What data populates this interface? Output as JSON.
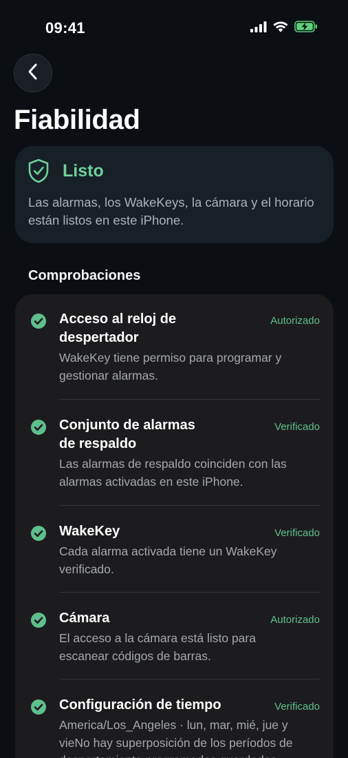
{
  "status_bar": {
    "time": "09:41"
  },
  "header": {
    "title": "Fiabilidad"
  },
  "status_card": {
    "title": "Listo",
    "description": "Las alarmas, los WakeKeys, la cámara y el horario están listos en este iPhone."
  },
  "checks": {
    "heading": "Comprobaciones",
    "items": [
      {
        "title_lines": [
          "Acceso al reloj de",
          "despertador"
        ],
        "badge": "Autorizado",
        "description_lines": [
          "WakeKey tiene permiso para programar y",
          "gestionar alarmas."
        ]
      },
      {
        "title_lines": [
          "Conjunto de alarmas",
          "de respaldo"
        ],
        "badge": "Verificado",
        "description_lines": [
          "Las alarmas de respaldo coinciden con las",
          "alarmas activadas en este iPhone."
        ]
      },
      {
        "title_lines": [
          "WakeKey"
        ],
        "badge": "Verificado",
        "description_lines": [
          "Cada alarma activada tiene un WakeKey",
          "verificado."
        ]
      },
      {
        "title_lines": [
          "Cámara"
        ],
        "badge": "Autorizado",
        "description_lines": [
          "El acceso a la cámara está listo para",
          "escanear códigos de barras."
        ]
      },
      {
        "title_lines": [
          "Configuración de tiempo"
        ],
        "badge": "Verificado",
        "description_lines": [
          "America/Los_Angeles · lun, mar, mié, jue y",
          "vieNo hay superposición de los períodos de",
          "despertamiento programados guardados"
        ]
      }
    ]
  },
  "colors": {
    "background": "#0b0f14",
    "accent_green": "#6fd09c",
    "card_status": "#172026",
    "card_checks": "#1c1c1e"
  },
  "icons": {
    "back": "chevron-left-icon",
    "status": "shield-check-icon",
    "check": "checkmark-circle-icon"
  }
}
